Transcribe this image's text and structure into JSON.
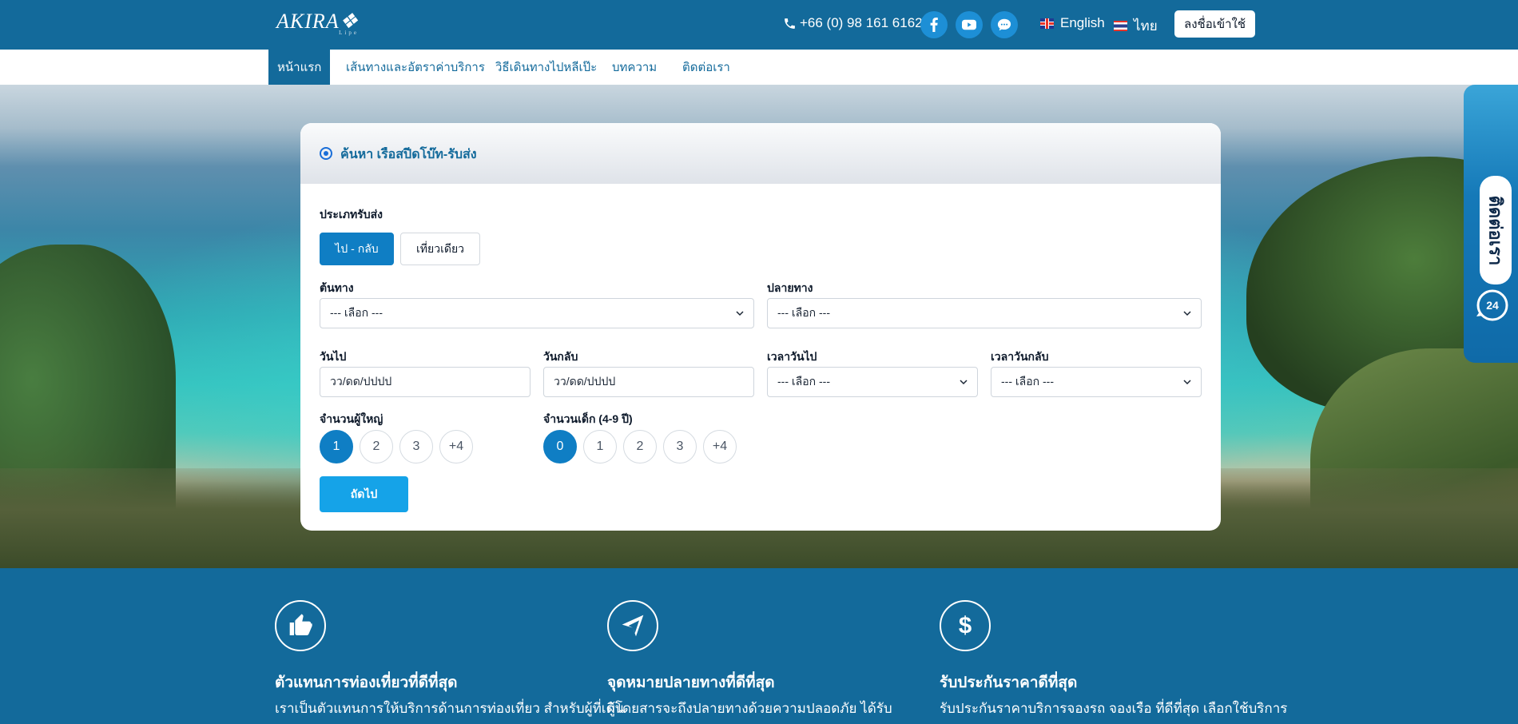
{
  "header": {
    "logo_text": "AKIRA",
    "logo_sub": "Lipe",
    "phone": "+66 (0) 98 161 6162",
    "social": [
      "facebook-icon",
      "youtube-icon",
      "chat-icon"
    ],
    "lang_en": "English",
    "lang_th": "ไทย",
    "login_label": "ลงชื่อเข้าใช้"
  },
  "nav": {
    "items": [
      {
        "label": "หน้าแรก"
      },
      {
        "label": "เส้นทางและอัตราค่าบริการ"
      },
      {
        "label": "วิธีเดินทางไปหลีเป๊ะ"
      },
      {
        "label": "บทความ"
      },
      {
        "label": "ติดต่อเรา"
      }
    ]
  },
  "search": {
    "title": "ค้นหา เรือสปีดโบ๊ท-รับส่ง",
    "trip_type_label": "ประเภทรับส่ง",
    "trip_round": "ไป - กลับ",
    "trip_oneway": "เที่ยวเดียว",
    "origin_label": "ต้นทาง",
    "origin_value": "--- เลือก ---",
    "dest_label": "ปลายทาง",
    "dest_value": "--- เลือก ---",
    "depart_label": "วันไป",
    "depart_value": "วว/ดด/ปปปป",
    "return_label": "วันกลับ",
    "return_value": "วว/ดด/ปปปป",
    "depart_time_label": "เวลาวันไป",
    "depart_time_value": "--- เลือก ---",
    "return_time_label": "เวลาวันกลับ",
    "return_time_value": "--- เลือก ---",
    "adults_label": "จำนวนผู้ใหญ่",
    "adults": [
      "1",
      "2",
      "3",
      "+4"
    ],
    "children_label": "จำนวนเด็ก (4-9 ปี)",
    "children": [
      "0",
      "1",
      "2",
      "3",
      "+4"
    ],
    "next_label": "ถัดไป"
  },
  "contact_tab": {
    "label": "ติดต่อเรา",
    "badge": "24"
  },
  "features": [
    {
      "icon": "thumbs-up-icon",
      "title": "ตัวแทนการท่องเที่ยวที่ดีที่สุด",
      "text": "เราเป็นตัวแทนการให้บริการด้านการท่องเที่ยว สำหรับผู้ที่เดิน"
    },
    {
      "icon": "paper-plane-icon",
      "title": "จุดหมายปลายทางที่ดีที่สุด",
      "text": "ผู้โดยสารจะถึงปลายทางด้วยความปลอดภัย ได้รับ"
    },
    {
      "icon": "dollar-icon",
      "title": "รับประกันราคาดีที่สุด",
      "text": "รับประกันราคาบริการจองรถ จองเรือ ที่ดีที่สุด เลือกใช้บริการ"
    }
  ],
  "colors": {
    "brand": "#136a9b",
    "accent": "#0f7ec4",
    "button": "#15a3e8"
  }
}
